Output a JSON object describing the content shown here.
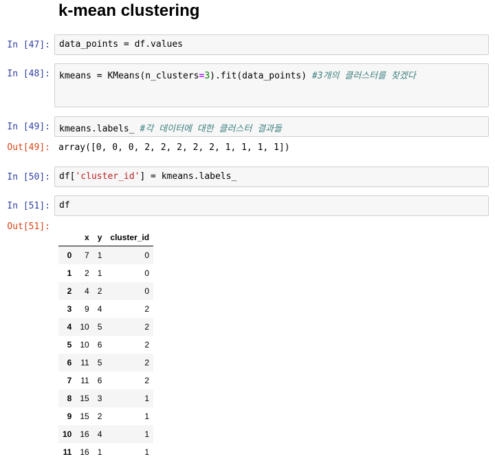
{
  "heading": "k-mean clustering",
  "cells": [
    {
      "prompt": "In [47]:",
      "code": [
        {
          "t": "data_points = df.values"
        }
      ]
    },
    {
      "prompt": "In [48]:",
      "code": [
        {
          "t": "kmeans = KMeans(n_clusters"
        },
        {
          "t": "=",
          "c": "tok-op"
        },
        {
          "t": "3",
          "c": "tok-num"
        },
        {
          "t": ").fit(data_points) "
        },
        {
          "t": "#3개의 클러스터를 찾겠다",
          "c": "tok-cmt"
        }
      ]
    },
    {
      "prompt": "In [49]:",
      "code": [
        {
          "t": "kmeans.labels_ "
        },
        {
          "t": "#각 데이터에 대한 클러스터 결과들",
          "c": "tok-cmt"
        }
      ]
    },
    {
      "prompt": "In [50]:",
      "code": [
        {
          "t": "df["
        },
        {
          "t": "'cluster_id'",
          "c": "tok-str"
        },
        {
          "t": "] = kmeans.labels_"
        }
      ]
    },
    {
      "prompt": "In [51]:",
      "code": [
        {
          "t": "df"
        }
      ]
    }
  ],
  "outputs": {
    "out49_prompt": "Out[49]:",
    "out49_text": "array([0, 0, 0, 2, 2, 2, 2, 2, 1, 1, 1, 1])",
    "out51_prompt": "Out[51]:"
  },
  "dataframe": {
    "columns": [
      "",
      "x",
      "y",
      "cluster_id"
    ],
    "rows": [
      [
        "0",
        "7",
        "1",
        "0"
      ],
      [
        "1",
        "2",
        "1",
        "0"
      ],
      [
        "2",
        "4",
        "2",
        "0"
      ],
      [
        "3",
        "9",
        "4",
        "2"
      ],
      [
        "4",
        "10",
        "5",
        "2"
      ],
      [
        "5",
        "10",
        "6",
        "2"
      ],
      [
        "6",
        "11",
        "5",
        "2"
      ],
      [
        "7",
        "11",
        "6",
        "2"
      ],
      [
        "8",
        "15",
        "3",
        "1"
      ],
      [
        "9",
        "15",
        "2",
        "1"
      ],
      [
        "10",
        "16",
        "4",
        "1"
      ],
      [
        "11",
        "16",
        "1",
        "1"
      ]
    ]
  }
}
